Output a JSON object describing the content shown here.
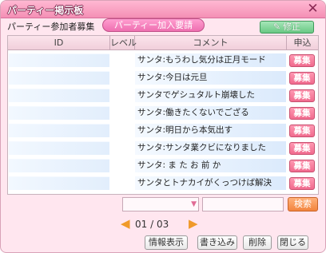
{
  "window": {
    "title": "パーティー掲示板",
    "close_icon": "close-icon"
  },
  "tabs": {
    "members_recruit": "パーティー参加者募集",
    "join_request": "パーティー加入要請"
  },
  "toolbar": {
    "edit_label": "修正"
  },
  "table": {
    "headers": {
      "id": "ID",
      "level": "レベル",
      "comment": "コメント",
      "apply": "申込"
    },
    "recruit_label": "募集",
    "rows": [
      {
        "id": "",
        "level": "",
        "comment": "サンタ:もうわし気分は正月モード"
      },
      {
        "id": "",
        "level": "",
        "comment": "サンタ:今日は元旦"
      },
      {
        "id": "",
        "level": "",
        "comment": "サンタでゲシュタルト崩壊した"
      },
      {
        "id": "",
        "level": "",
        "comment": "サンタ:働きたくないでござる"
      },
      {
        "id": "",
        "level": "",
        "comment": "サンタ:明日から本気出す"
      },
      {
        "id": "",
        "level": "",
        "comment": "サンタ:サンタ業クビになりました"
      },
      {
        "id": "",
        "level": "",
        "comment": "サンタ:  ま た お 前 か"
      },
      {
        "id": "",
        "level": "",
        "comment": "サンタとトナカイがくっつけば解決"
      }
    ]
  },
  "search": {
    "select_value": "",
    "input_value": "",
    "button_label": "検索"
  },
  "pager": {
    "text": "01 / 03"
  },
  "footer": {
    "info_label": "情報表示",
    "write_label": "書き込み",
    "delete_label": "削除",
    "close_label": "閉じる"
  },
  "colors": {
    "title_bar": "#f48fb5",
    "recruit_button": "#f06b8e",
    "edit_button": "#69c884",
    "search_button": "#f2853e",
    "pager_arrow": "#f09a2a"
  }
}
